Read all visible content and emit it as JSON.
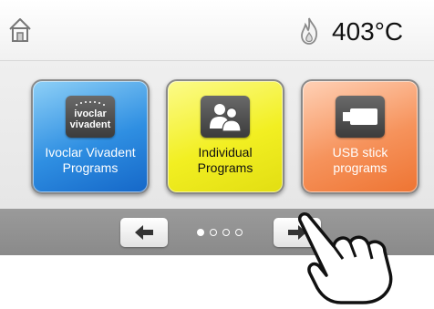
{
  "statusbar": {
    "home_icon": "home-icon",
    "heater_icon": "flame-icon",
    "temperature": "403°C"
  },
  "tiles": [
    {
      "label": "Ivoclar Vivadent\nPrograms",
      "logo_text": "ivoclar vivadent",
      "color": "#2f8fe2",
      "icon": "ivoclar-logo-icon"
    },
    {
      "label": "Individual\nPrograms",
      "color": "#f2ef22",
      "icon": "users-icon"
    },
    {
      "label": "USB stick\nprograms",
      "color": "#f6935c",
      "icon": "usb-stick-icon"
    }
  ],
  "navigation": {
    "prev_icon": "arrow-left-icon",
    "next_icon": "arrow-right-icon",
    "page_count": 4,
    "current_page": 1
  },
  "overlay": {
    "icon": "pointing-hand-icon"
  }
}
